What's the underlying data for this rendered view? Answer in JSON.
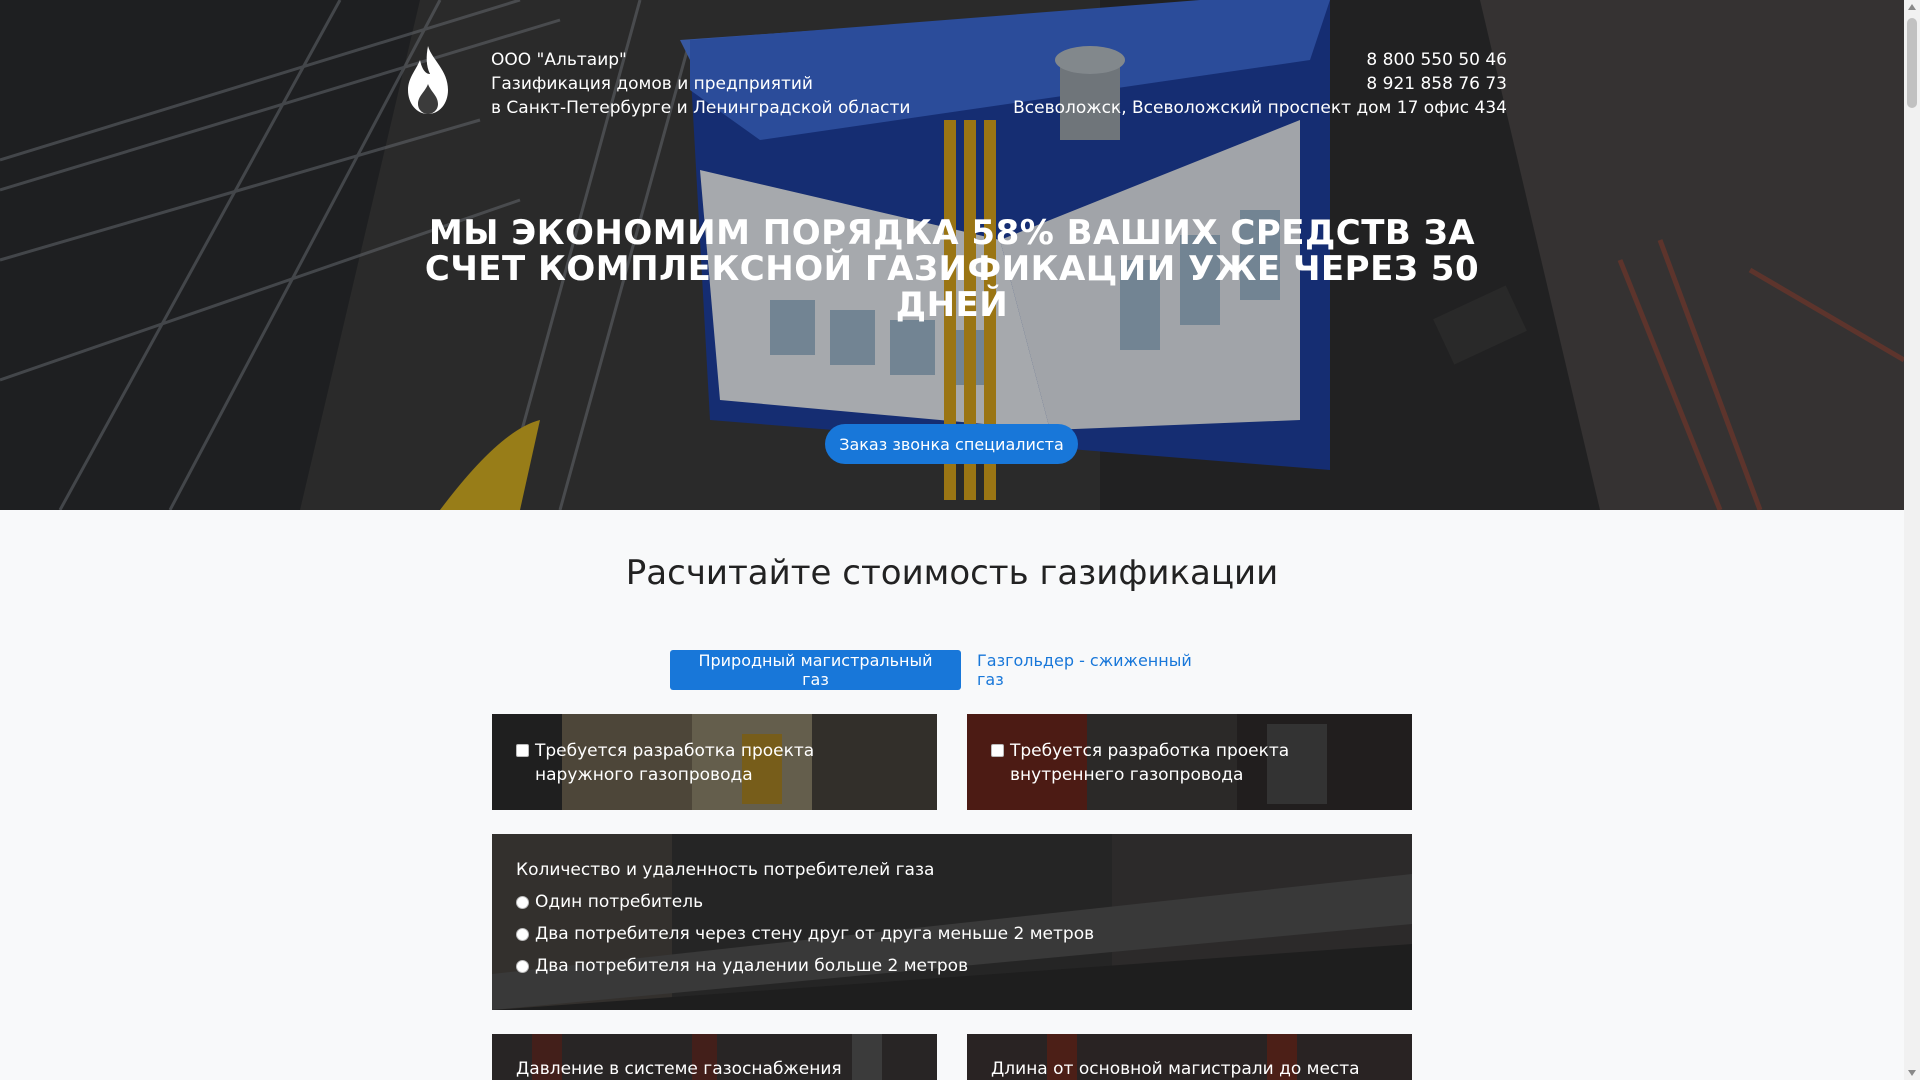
{
  "header": {
    "company_name": "ООО \"Альтаир\"",
    "tagline_1": "Газификация домов и предприятий",
    "tagline_2": "в Санкт-Петербурге и Ленинградской области",
    "phone_1": "8 800 550 50 46",
    "phone_2": "8 921 858 76 73",
    "address": "Всеволожск, Всеволожский проспект дом 17 офис 434",
    "logo_icon": "flame-icon"
  },
  "hero": {
    "headline": "МЫ ЭКОНОМИМ ПОРЯДКА 58% ВАШИХ СРЕДСТВ ЗА СЧЕТ КОМПЛЕКСНОЙ ГАЗИФИКАЦИИ УЖЕ ЧЕРЕЗ 50 ДНЕЙ",
    "cta_label": "Заказ звонка специалиста"
  },
  "calculator": {
    "title": "Расчитайте стоимость газификации",
    "tabs": [
      {
        "label": "Природный магистральный газ",
        "active": true
      },
      {
        "label": "Газгольдер - сжиженный газ",
        "active": false
      }
    ],
    "options": [
      {
        "label": "Требуется разработка проекта наружного газопровода",
        "checked": false
      },
      {
        "label": "Требуется разработка проекта внутреннего газопровода",
        "checked": false
      }
    ],
    "consumers": {
      "title": "Количество и удаленность потребителей газа",
      "choices": [
        "Один потребитель",
        "Два потребителя через стену друг от друга меньше 2 метров",
        "Два потребителя на удалении больше 2 метров"
      ]
    },
    "pressure_title": "Давление в системе газоснабжения",
    "length_title": "Длина от основной магистрали до места"
  },
  "colors": {
    "accent": "#1877d9",
    "page_bg": "#f8f9fa"
  }
}
